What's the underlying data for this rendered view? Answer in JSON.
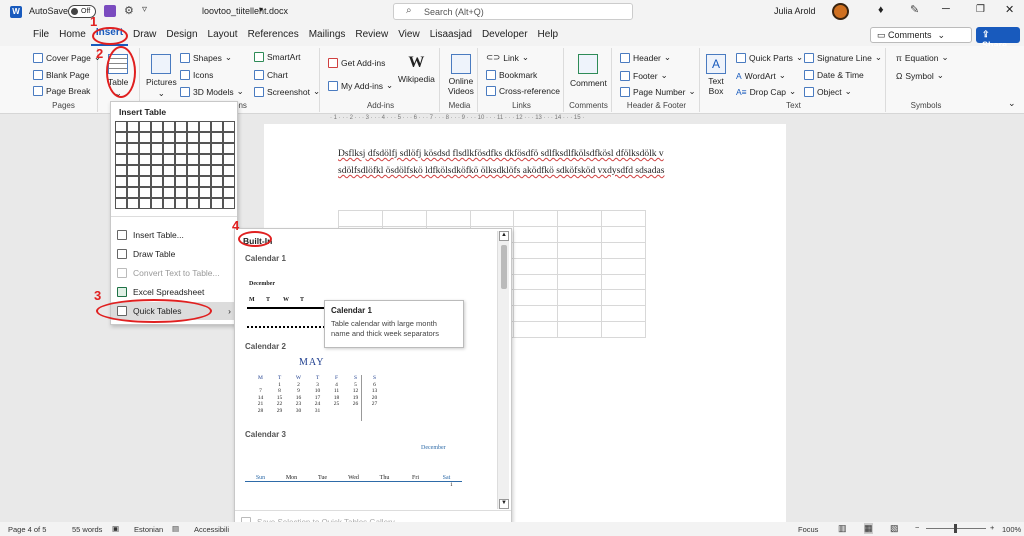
{
  "titlebar": {
    "autosave_label": "AutoSave",
    "autosave_state": "Off",
    "filename": "loovtoo_tiitelleht.docx",
    "search_placeholder": "Search (Alt+Q)",
    "user": "Julia Arold",
    "word_icon": "W"
  },
  "menu": {
    "tabs": [
      "File",
      "Home",
      "Insert",
      "Draw",
      "Design",
      "Layout",
      "References",
      "Mailings",
      "Review",
      "View",
      "Lisaasjad",
      "Developer",
      "Help"
    ],
    "comments": "Comments",
    "share": "Share"
  },
  "ribbon": {
    "pages": {
      "cover": "Cover Page",
      "blank": "Blank Page",
      "break": "Page Break",
      "label": "Pages"
    },
    "table": {
      "label": "Table"
    },
    "illus": {
      "pictures": "Pictures",
      "shapes": "Shapes",
      "icons": "Icons",
      "models": "3D Models",
      "smartart": "SmartArt",
      "chart": "Chart",
      "screenshot": "Screenshot"
    },
    "addins": {
      "get": "Get Add-ins",
      "my": "My Add-ins",
      "wiki": "Wikipedia",
      "label": "Add-ins"
    },
    "media": {
      "online": "Online",
      "videos": "Videos",
      "label": "Media"
    },
    "links": {
      "link": "Link",
      "bookmark": "Bookmark",
      "cross": "Cross-reference",
      "label": "Links"
    },
    "comments": {
      "comment": "Comment",
      "label": "Comments"
    },
    "hf": {
      "header": "Header",
      "footer": "Footer",
      "pagenum": "Page Number",
      "label": "Header & Footer"
    },
    "text": {
      "textbox1": "Text",
      "textbox2": "Box",
      "quickparts": "Quick Parts",
      "wordart": "WordArt",
      "dropcap": "Drop Cap",
      "sigline": "Signature Line",
      "datetime": "Date & Time",
      "object": "Object",
      "label": "Text"
    },
    "symbols": {
      "equation": "Equation",
      "symbol": "Symbol",
      "label": "Symbols"
    },
    "illus_label": "ons"
  },
  "annotations": [
    "1",
    "2",
    "3",
    "4"
  ],
  "tablemenu": {
    "title": "Insert Table",
    "items": [
      "Insert Table...",
      "Draw Table",
      "Convert Text to Table...",
      "Excel Spreadsheet",
      "Quick Tables"
    ]
  },
  "gallery": {
    "heading": "Built-In",
    "cal1": {
      "name": "Calendar 1",
      "month": "December",
      "days": [
        "M",
        "T",
        "W",
        "T"
      ]
    },
    "cal2": {
      "name": "Calendar 2",
      "month": "MAY",
      "days": [
        "M",
        "T",
        "W",
        "T",
        "F",
        "S",
        "S"
      ],
      "rows": [
        [
          "",
          "1",
          "2",
          "3",
          "4",
          "5",
          "6"
        ],
        [
          "7",
          "8",
          "9",
          "10",
          "11",
          "12",
          "13"
        ],
        [
          "14",
          "15",
          "16",
          "17",
          "18",
          "19",
          "20"
        ],
        [
          "21",
          "22",
          "23",
          "24",
          "25",
          "26",
          "27"
        ],
        [
          "28",
          "29",
          "30",
          "31",
          "",
          "",
          ""
        ]
      ]
    },
    "cal3": {
      "name": "Calendar 3",
      "month": "December",
      "days": [
        "Sun",
        "Mon",
        "Tue",
        "Wed",
        "Thu",
        "Fri",
        "Sat"
      ],
      "first": "1"
    },
    "save": "Save Selection to Quick Tables Gallery..."
  },
  "tooltip": {
    "title": "Calendar 1",
    "desc": "Table calendar with large month name and thick week separators"
  },
  "document": {
    "line1": "Dsflksj dfsdölfj sdlöfj kösdsd flsdlkfösdfks dkfösdfö sdlfksdlfkölsdfkösl dfölksdölk v",
    "line2": "sdölfsdlöfkl ösdölfskö ldfkölsdköfkö ölksdklöfs aködfkö sdköfsköd vxdysdfd sdsadas"
  },
  "ruler": "· 1 · · · 2 · · · 3 · · · 4 · · · 5 · · · 6 · · · 7 · · · 8 · · · 9 · · · 10 · · · 11 · · · 12 · · · 13 · · · 14 · · · 15 ·",
  "status": {
    "page": "Page 4 of 5",
    "words": "55 words",
    "lang": "Estonian",
    "access": "Accessibili",
    "focus": "Focus",
    "zoom": "100%"
  }
}
